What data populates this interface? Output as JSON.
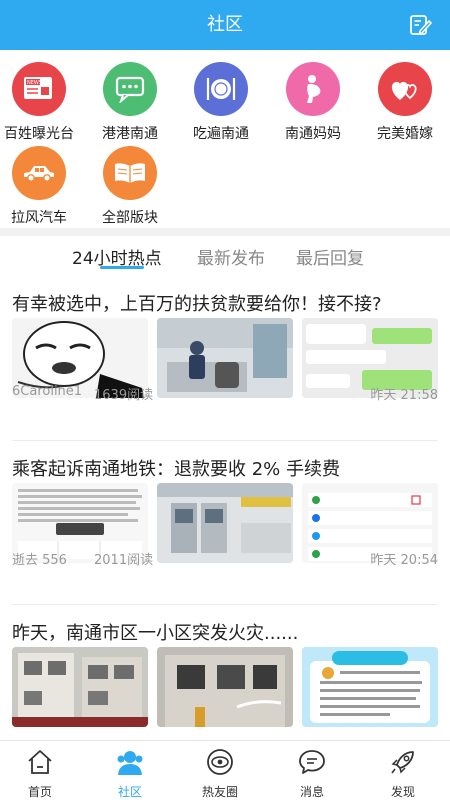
{
  "header": {
    "title": "社区"
  },
  "boards": [
    {
      "label": "百姓曝光台",
      "icon": "news-icon",
      "color": "#e8454a"
    },
    {
      "label": "港港南通",
      "icon": "chat-bubble-icon",
      "color": "#4cbd72"
    },
    {
      "label": "吃遍南通",
      "icon": "plate-cutlery-icon",
      "color": "#5c6fd6"
    },
    {
      "label": "南通妈妈",
      "icon": "pregnant-mother-icon",
      "color": "#f06aaa"
    },
    {
      "label": "完美婚嫁",
      "icon": "hearts-icon",
      "color": "#e8454a"
    },
    {
      "label": "拉风汽车",
      "icon": "car-icon",
      "color": "#f3883a"
    },
    {
      "label": "全部版块",
      "icon": "book-icon",
      "color": "#f3883a"
    }
  ],
  "tabs": [
    "24小时热点",
    "最新发布",
    "最后回复"
  ],
  "posts": [
    {
      "title": "有幸被选中，上百万的扶贫款要给你！接不接?",
      "author": "6Caroline1",
      "reads": "1639阅读",
      "time": "昨天 21:58"
    },
    {
      "title": "乘客起诉南通地铁：退款要收 2% 手续费",
      "author": "逝去 556",
      "reads": "2011阅读",
      "time": "昨天 20:54"
    },
    {
      "title": "昨天，南通市区一小区突发火灾......",
      "author": "",
      "reads": "",
      "time": ""
    }
  ],
  "tabbar": [
    {
      "label": "首页",
      "icon": "home-icon"
    },
    {
      "label": "社区",
      "icon": "community-icon"
    },
    {
      "label": "热友圈",
      "icon": "eye-circle-icon"
    },
    {
      "label": "消息",
      "icon": "message-icon"
    },
    {
      "label": "发现",
      "icon": "rocket-icon"
    }
  ],
  "colors": {
    "accent": "#2fa9f0"
  }
}
